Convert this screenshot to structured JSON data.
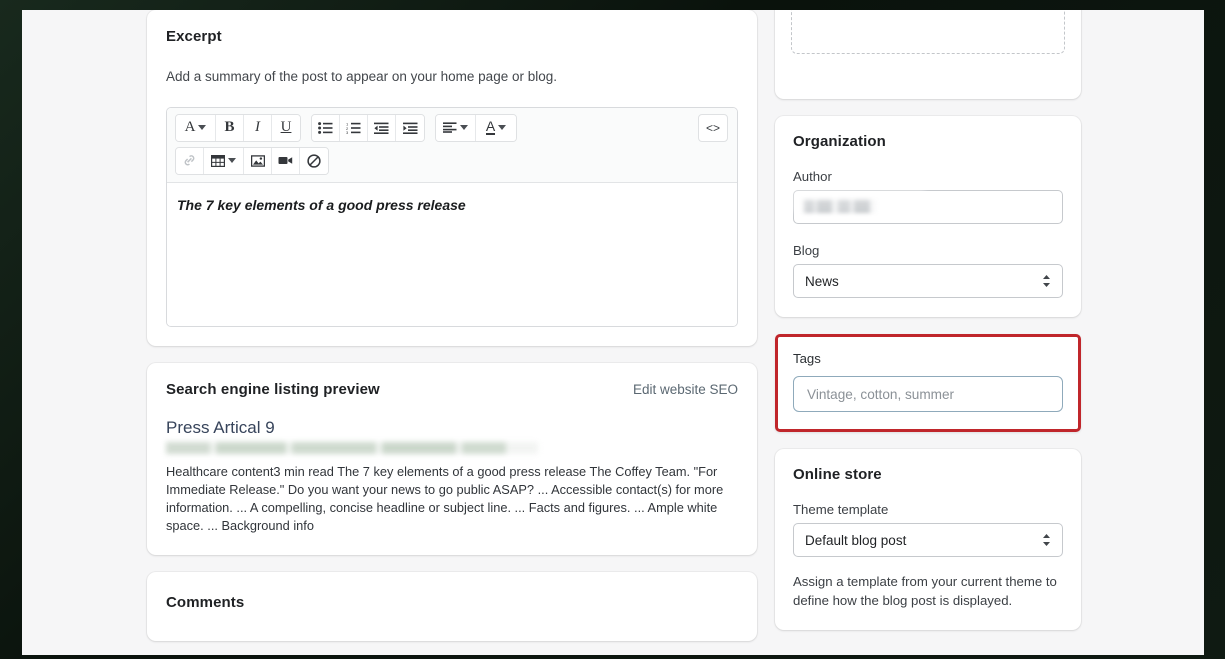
{
  "excerpt": {
    "title": "Excerpt",
    "helper": "Add a summary of the post to appear on your home page or blog.",
    "editor_content": "The 7 key elements of a good press release",
    "toolbar": {
      "font_style": "A",
      "bold": "B",
      "italic": "I",
      "underline": "U",
      "bulleted_list": "bulleted-list-icon",
      "numbered_list": "numbered-list-icon",
      "outdent": "outdent-icon",
      "indent": "indent-icon",
      "align": "align-left-icon",
      "text_color": "A",
      "link": "link-icon",
      "table": "table-icon",
      "image": "image-icon",
      "video": "video-icon",
      "clear_formatting": "no-formatting-icon",
      "code_view": "<>"
    }
  },
  "seo": {
    "title": "Search engine listing preview",
    "edit_link": "Edit website SEO",
    "result_title": "Press Artical 9",
    "result_url": "",
    "result_description": "Healthcare content3 min read The 7 key elements of a good press release The Coffey Team. \"For Immediate Release.\" Do you want your news to go public ASAP? ... Accessible contact(s) for more information. ... A compelling, concise headline or subject line. ... Facts and figures. ... Ample white space. ... Background info"
  },
  "comments": {
    "title": "Comments"
  },
  "organization": {
    "title": "Organization",
    "author_label": "Author",
    "author_value": "",
    "blog_label": "Blog",
    "blog_value": "News"
  },
  "tags": {
    "label": "Tags",
    "placeholder": "Vintage, cotton, summer",
    "value": "",
    "highlight_color": "#c0262b"
  },
  "online_store": {
    "title": "Online store",
    "theme_template_label": "Theme template",
    "theme_template_value": "Default blog post",
    "help_text": "Assign a template from your current theme to define how the blog post is displayed."
  }
}
